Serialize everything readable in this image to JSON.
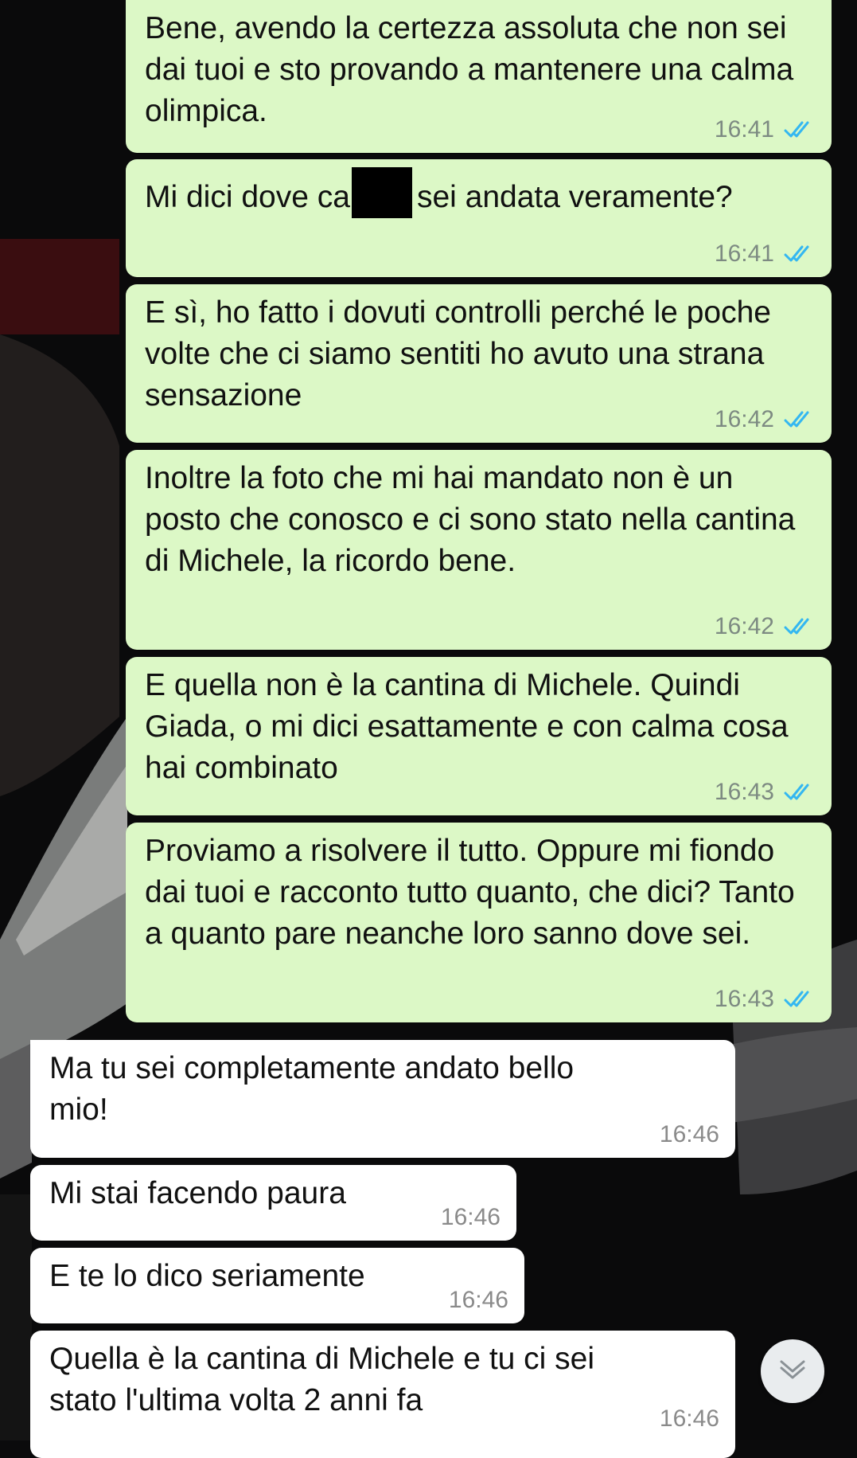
{
  "messages": [
    {
      "dir": "out",
      "text": "Bene, avendo la certezza assoluta che non sei dai tuoi e sto provando a mantenere una calma olimpica.",
      "time": "16:41",
      "status": "read"
    },
    {
      "dir": "out",
      "text_before": "Mi dici dove ca",
      "text_after": "sei andata veramente?",
      "redacted": true,
      "time": "16:41",
      "status": "read"
    },
    {
      "dir": "out",
      "text": "E sì, ho fatto i dovuti controlli perché le poche volte che ci siamo sentiti ho avuto una strana sensazione",
      "time": "16:42",
      "status": "read"
    },
    {
      "dir": "out",
      "text": "Inoltre la foto che mi hai mandato non è un posto che conosco e ci sono stato nella cantina di Michele, la ricordo bene.",
      "time": "16:42",
      "status": "read"
    },
    {
      "dir": "out",
      "text": "E quella non è la cantina di Michele. Quindi Giada, o mi dici esattamente e con calma cosa hai combinato",
      "time": "16:43",
      "status": "read"
    },
    {
      "dir": "out",
      "text": "Proviamo a risolvere il tutto. Oppure mi fiondo dai tuoi e racconto tutto quanto, che dici? Tanto a quanto pare neanche loro sanno dove sei.",
      "time": "16:43",
      "status": "read"
    },
    {
      "dir": "in",
      "text": "Ma tu sei completamente andato bello mio!",
      "time": "16:46"
    },
    {
      "dir": "in",
      "text": "Mi stai facendo paura",
      "time": "16:46"
    },
    {
      "dir": "in",
      "text": "E te lo dico seriamente",
      "time": "16:46"
    },
    {
      "dir": "in",
      "text": "Quella è la cantina di Michele e tu ci sei stato l'ultima volta 2 anni fa",
      "time": "16:46"
    }
  ],
  "colors": {
    "outgoing_bubble": "#dcf8c6",
    "incoming_bubble": "#ffffff",
    "read_ticks": "#34b7f1",
    "timestamp": "#7d8a82"
  },
  "scroll_down_button": {
    "icon": "chevron-down-icon"
  }
}
